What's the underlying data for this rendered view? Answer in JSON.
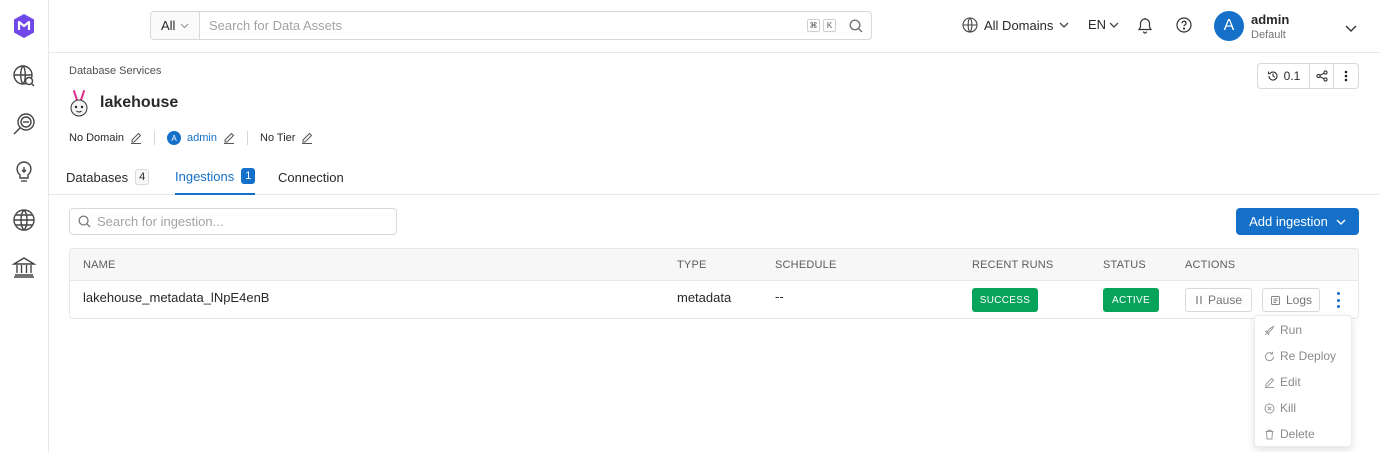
{
  "topbar": {
    "search_scope": "All",
    "search_placeholder": "Search for Data Assets",
    "shortcut_keys": [
      "⌘",
      "K"
    ],
    "domains_label": "All Domains",
    "language": "EN",
    "user": {
      "initial": "A",
      "name": "admin",
      "role": "Default"
    }
  },
  "sidebar": {
    "items": [
      "app-logo-icon",
      "explore-icon",
      "observability-icon",
      "insights-icon",
      "domains-icon",
      "governance-icon"
    ]
  },
  "header": {
    "breadcrumb": "Database Services",
    "title": "lakehouse",
    "domain": "No Domain",
    "owner_initial": "A",
    "owner": "admin",
    "tier": "No Tier",
    "version": "0.1"
  },
  "tabs": [
    {
      "label": "Databases",
      "count": "4"
    },
    {
      "label": "Ingestions",
      "count": "1"
    },
    {
      "label": "Connection"
    }
  ],
  "ingestions": {
    "search_placeholder": "Search for ingestion...",
    "add_label": "Add ingestion",
    "columns": [
      "NAME",
      "TYPE",
      "SCHEDULE",
      "RECENT RUNS",
      "STATUS",
      "ACTIONS"
    ],
    "rows": [
      {
        "name": "lakehouse_metadata_lNpE4enB",
        "type": "metadata",
        "schedule": "--",
        "recent_run": "SUCCESS",
        "status": "ACTIVE",
        "pause_label": "Pause",
        "logs_label": "Logs"
      }
    ],
    "menu": [
      "Run",
      "Re Deploy",
      "Edit",
      "Kill",
      "Delete"
    ]
  },
  "colors": {
    "primary": "#1470c8",
    "success": "#07a35a",
    "border": "#e8e8e8"
  }
}
